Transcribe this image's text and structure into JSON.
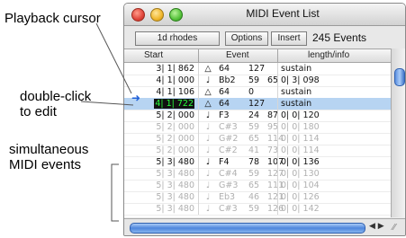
{
  "callouts": {
    "playback_cursor": "Playback cursor",
    "double_click_line1": "double-click",
    "double_click_line2": "to edit",
    "simultaneous_line1": "simultaneous",
    "simultaneous_line2": "MIDI events"
  },
  "window": {
    "title": "MIDI Event List",
    "track_button": "1d rhodes",
    "options_button": "Options",
    "insert_button": "Insert",
    "event_count": "245 Events"
  },
  "columns": {
    "start": "Start",
    "event": "Event",
    "length": "length/info"
  },
  "rows": [
    {
      "start": "3| 1| 862",
      "icon": "△",
      "e1": "64",
      "e2": "127",
      "e3": "",
      "len": "sustain",
      "style": "normal"
    },
    {
      "start": "4| 1| 000",
      "icon": "♩",
      "e1": "Bb2",
      "e2": "59",
      "e3": "65",
      "len": "0| 3| 098",
      "style": "normal"
    },
    {
      "start": "4| 1| 106",
      "icon": "△",
      "e1": "64",
      "e2": "0",
      "e3": "",
      "len": "sustain",
      "style": "normal"
    },
    {
      "start": "4| 1| 722",
      "icon": "△",
      "e1": "64",
      "e2": "127",
      "e3": "",
      "len": "sustain",
      "style": "selected"
    },
    {
      "start": "5| 2| 000",
      "icon": "♩",
      "e1": "F3",
      "e2": "24",
      "e3": "87",
      "len": "0| 0| 120",
      "style": "normal"
    },
    {
      "start": "5| 2| 000",
      "icon": "♩",
      "e1": "C#3",
      "e2": "59",
      "e3": "95",
      "len": "0| 0| 180",
      "style": "dim"
    },
    {
      "start": "5| 2| 000",
      "icon": "♩",
      "e1": "G#2",
      "e2": "65",
      "e3": "114",
      "len": "0| 0| 114",
      "style": "dim"
    },
    {
      "start": "5| 2| 000",
      "icon": "♩",
      "e1": "C#2",
      "e2": "41",
      "e3": "73",
      "len": "0| 0| 114",
      "style": "dim"
    },
    {
      "start": "5| 3| 480",
      "icon": "♩",
      "e1": "F4",
      "e2": "78",
      "e3": "107",
      "len": "0| 0| 136",
      "style": "normal"
    },
    {
      "start": "5| 3| 480",
      "icon": "♩",
      "e1": "C#4",
      "e2": "59",
      "e3": "127",
      "len": "0| 0| 130",
      "style": "dim"
    },
    {
      "start": "5| 3| 480",
      "icon": "♩",
      "e1": "G#3",
      "e2": "65",
      "e3": "111",
      "len": "0| 0| 104",
      "style": "dim"
    },
    {
      "start": "5| 3| 480",
      "icon": "♩",
      "e1": "Eb3",
      "e2": "46",
      "e3": "121",
      "len": "0| 0| 126",
      "style": "dim"
    },
    {
      "start": "5| 3| 480",
      "icon": "♩",
      "e1": "C#3",
      "e2": "59",
      "e3": "126",
      "len": "0| 0| 142",
      "style": "dim"
    }
  ]
}
